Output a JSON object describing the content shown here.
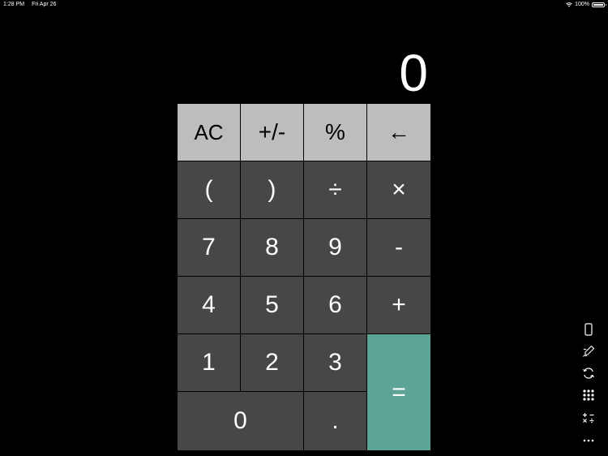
{
  "status_bar": {
    "time": "1:28 PM",
    "date": "Fri Apr 26",
    "battery": "100%"
  },
  "display": {
    "value": "0"
  },
  "keys": {
    "ac": "AC",
    "plus_minus": "+/-",
    "percent": "%",
    "backspace": "←",
    "open_paren": "(",
    "close_paren": ")",
    "divide": "÷",
    "multiply": "×",
    "seven": "7",
    "eight": "8",
    "nine": "9",
    "minus": "-",
    "four": "4",
    "five": "5",
    "six": "6",
    "plus": "+",
    "one": "1",
    "two": "2",
    "three": "3",
    "equals": "=",
    "zero": "0",
    "decimal": "."
  },
  "side_toolbar": {
    "icons": [
      "phone-icon",
      "pen-icon",
      "refresh-icon",
      "keypad-grid-icon",
      "operators-icon",
      "more-icon"
    ]
  },
  "colors": {
    "background": "#000000",
    "function_key": "#bdbdbd",
    "number_key": "#474747",
    "equals_key": "#5da496"
  }
}
